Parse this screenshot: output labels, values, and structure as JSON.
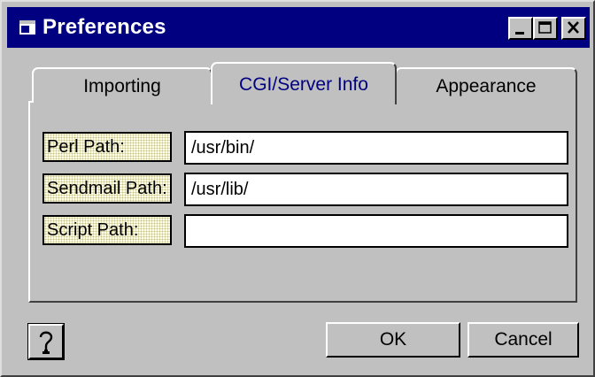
{
  "window": {
    "title": "Preferences",
    "icon": "app-window-icon",
    "controls": [
      "minimize-icon",
      "maximize-icon",
      "close-icon"
    ]
  },
  "tabs": [
    {
      "label": "Importing",
      "selected": false
    },
    {
      "label": "CGI/Server Info",
      "selected": true
    },
    {
      "label": "Appearance",
      "selected": false
    }
  ],
  "fields": [
    {
      "label": "Perl Path:",
      "value": "/usr/bin/"
    },
    {
      "label": "Sendmail Path:",
      "value": "/usr/lib/"
    },
    {
      "label": "Script Path:",
      "value": ""
    }
  ],
  "buttons": {
    "help_icon": "help-question-icon",
    "ok": "OK",
    "cancel": "Cancel"
  },
  "colors": {
    "titlebar": "#000080",
    "face": "#c0c0c0",
    "selected_tab_text": "#000080",
    "label_bg": "#ffffe6"
  }
}
